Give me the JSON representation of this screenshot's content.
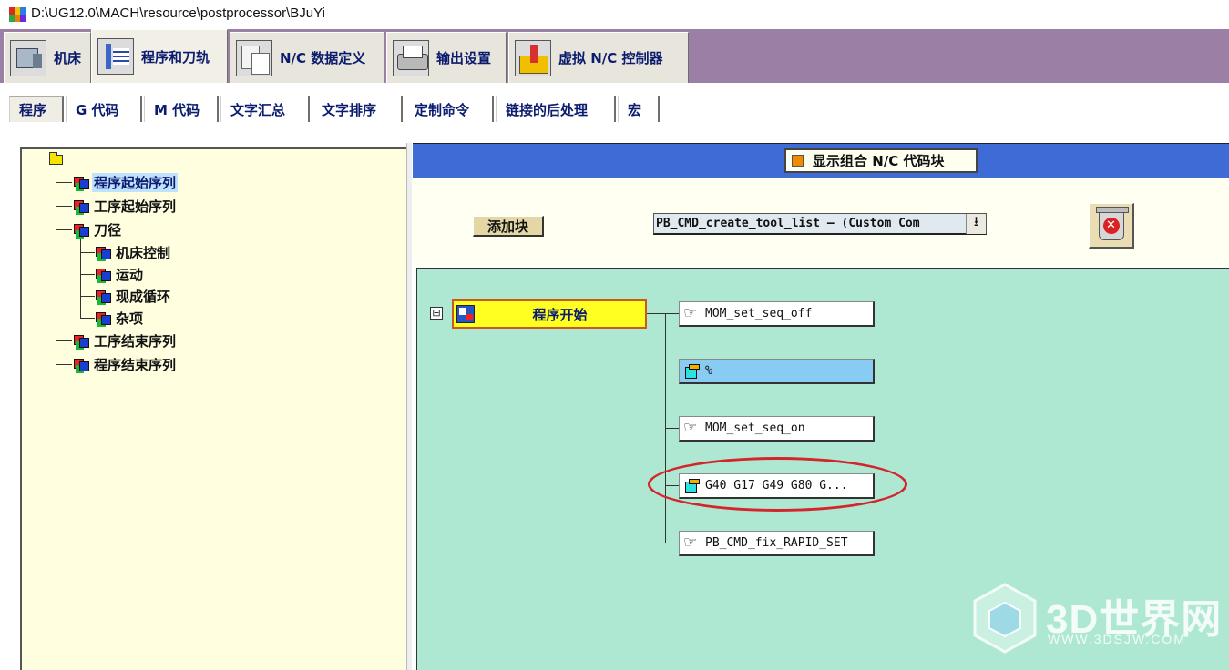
{
  "window": {
    "title": "D:\\UG12.0\\MACH\\resource\\postprocessor\\BJuYi"
  },
  "main_tabs": [
    {
      "label": "机床",
      "icon": "machine-icon"
    },
    {
      "label": "程序和刀轨",
      "icon": "program-toolpath-icon",
      "active": true
    },
    {
      "label": "N/C 数据定义",
      "icon": "nc-data-icon"
    },
    {
      "label": "输出设置",
      "icon": "printer-icon"
    },
    {
      "label": "虚拟 N/C 控制器",
      "icon": "virtual-controller-icon"
    }
  ],
  "sub_tabs": [
    {
      "label": "程序",
      "active": true
    },
    {
      "label": "G 代码"
    },
    {
      "label": "M 代码"
    },
    {
      "label": "文字汇总"
    },
    {
      "label": "文字排序"
    },
    {
      "label": "定制命令"
    },
    {
      "label": "链接的后处理"
    },
    {
      "label": "宏"
    }
  ],
  "tree": {
    "root_icon": "folder-icon",
    "items": [
      {
        "label": "程序起始序列",
        "selected": true
      },
      {
        "label": "工序起始序列"
      },
      {
        "label": "刀径"
      },
      {
        "label": "机床控制"
      },
      {
        "label": "运动"
      },
      {
        "label": "现成循环"
      },
      {
        "label": "杂项"
      },
      {
        "label": "工序结束序列"
      },
      {
        "label": "程序结束序列"
      }
    ]
  },
  "toolbar": {
    "display_combined_label": "显示组合 N/C 代码块",
    "display_combined_checked": true,
    "add_block_label": "添加块",
    "block_select_value": "PB_CMD_create_tool_list — (Custom Com",
    "trash_icon": "trash-delete-icon"
  },
  "sequence": {
    "event_label": "程序开始",
    "collapse_symbol": "⊟",
    "blocks": [
      {
        "label": "MOM_set_seq_off",
        "icon": "hand-pointer-icon"
      },
      {
        "label": "%",
        "icon": "block-cube-icon",
        "highlighted": true
      },
      {
        "label": "MOM_set_seq_on",
        "icon": "hand-pointer-icon"
      },
      {
        "label": "G40 G17 G49 G80 G...",
        "icon": "block-cube-icon",
        "circled": true
      },
      {
        "label": "PB_CMD_fix_RAPID_SET",
        "icon": "hand-pointer-icon"
      }
    ]
  },
  "watermark": {
    "brand": "3D世界网",
    "url": "WWW.3DSJW.COM"
  },
  "colors": {
    "tab_strip": "#9b7fa5",
    "header_bar": "#3f6bd6",
    "canvas": "#aee8d2",
    "tree_bg": "#ffffe0",
    "event_node": "#ffff22",
    "highlight_block": "#88ccf4",
    "annotation_circle": "#d4242c"
  }
}
